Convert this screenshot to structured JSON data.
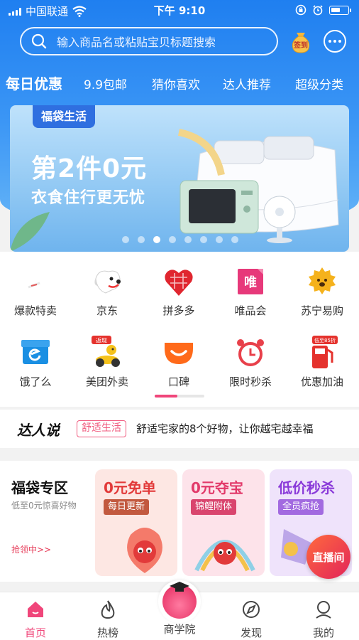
{
  "status_bar": {
    "carrier": "中国联通",
    "time": "下午 9:10"
  },
  "search": {
    "placeholder": "输入商品名或粘贴宝贝标题搜索"
  },
  "header": {
    "sign_in_label": "签到"
  },
  "tabs": [
    {
      "label": "每日优惠",
      "active": true
    },
    {
      "label": "9.9包邮"
    },
    {
      "label": "猜你喜欢"
    },
    {
      "label": "达人推荐"
    },
    {
      "label": "超级分类"
    }
  ],
  "banner": {
    "tag": "福袋生活",
    "headline": "第2件0元",
    "subheadline": "衣食住行更无忧",
    "slide_count": 8,
    "active_slide": 3
  },
  "categories": [
    {
      "label": "爆款特卖",
      "icon": "hot-deal-icon"
    },
    {
      "label": "京东",
      "icon": "jd-dog-icon"
    },
    {
      "label": "拼多多",
      "icon": "pinduoduo-icon"
    },
    {
      "label": "唯品会",
      "icon": "vip-icon",
      "glyph": "唯"
    },
    {
      "label": "苏宁易购",
      "icon": "suning-icon"
    },
    {
      "label": "饿了么",
      "icon": "eleme-icon"
    },
    {
      "label": "美团外卖",
      "icon": "meituan-icon",
      "badge": "返现"
    },
    {
      "label": "口碑",
      "icon": "koubei-icon"
    },
    {
      "label": "限时秒杀",
      "icon": "alarm-clock-icon"
    },
    {
      "label": "优惠加油",
      "icon": "fuel-pump-icon",
      "badge": "低至85折"
    }
  ],
  "talk": {
    "logo": "达人说",
    "badge": "舒适生活",
    "text": "舒适宅家的8个好物，让你越宅越幸福"
  },
  "zone": {
    "title": "福袋专区",
    "subtitle": "低至0元惊喜好物",
    "link": "抢领中>>",
    "cards": [
      {
        "title": "0元免单",
        "label": "每日更新",
        "title_color": "#e23a3a",
        "label_color": "#c2593f",
        "bg": "#fde7e3"
      },
      {
        "title": "0元夺宝",
        "label": "锦鲤附体",
        "title_color": "#e23a6a",
        "label_color": "#d9456e",
        "bg": "#fde3ea"
      },
      {
        "title": "低价秒杀",
        "label": "全员疯抢",
        "title_color": "#8a3ad9",
        "label_color": "#a26ae0",
        "bg": "#efe3fb"
      }
    ],
    "live_label": "直播间"
  },
  "tabbar": [
    {
      "label": "首页",
      "icon": "home-icon",
      "active": true
    },
    {
      "label": "热榜",
      "icon": "flame-icon"
    },
    {
      "label": "商学院",
      "icon": "academy-mascot-icon"
    },
    {
      "label": "发现",
      "icon": "compass-icon"
    },
    {
      "label": "我的",
      "icon": "profile-icon"
    }
  ],
  "colors": {
    "brand_blue": "#2a86f2",
    "accent_pink": "#f0467a"
  }
}
